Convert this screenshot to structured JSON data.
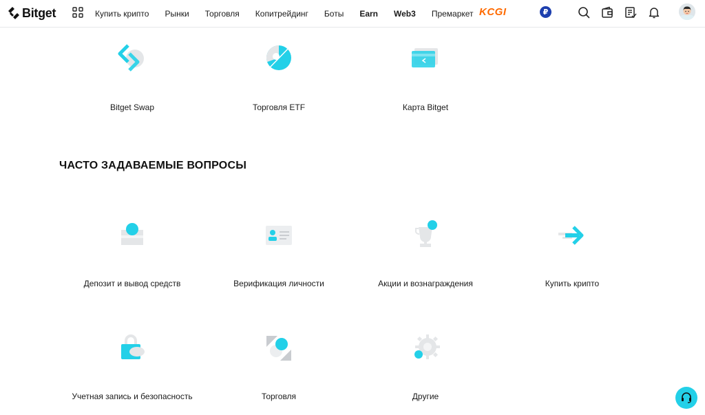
{
  "header": {
    "logo_text": "Bitget",
    "nav": [
      {
        "label": "Купить крипто",
        "bold": false
      },
      {
        "label": "Рынки",
        "bold": false
      },
      {
        "label": "Торговля",
        "bold": false
      },
      {
        "label": "Копитрейдинг",
        "bold": false
      },
      {
        "label": "Боты",
        "bold": false
      },
      {
        "label": "Earn",
        "bold": true
      },
      {
        "label": "Web3",
        "bold": true
      },
      {
        "label": "Премаркет",
        "bold": false
      }
    ],
    "promo_text": "KCGI",
    "currency_symbol": "₽",
    "tools": [
      "search-icon",
      "wallet-icon",
      "orders-icon",
      "bell-icon"
    ],
    "avatar": "avatar"
  },
  "products": [
    {
      "label": "Bitget Swap",
      "icon": "swap-icon"
    },
    {
      "label": "Торговля ETF",
      "icon": "etf-icon"
    },
    {
      "label": "Карта Bitget",
      "icon": "card-icon"
    }
  ],
  "faq": {
    "title": "ЧАСТО ЗАДАВАЕМЫЕ ВОПРОСЫ",
    "items": [
      {
        "label": "Депозит и вывод средств",
        "icon": "deposit-icon"
      },
      {
        "label": "Верификация личности",
        "icon": "id-card-icon"
      },
      {
        "label": "Акции и вознаграждения",
        "icon": "trophy-icon"
      },
      {
        "label": "Купить крипто",
        "icon": "arrow-right-icon"
      },
      {
        "label": "Учетная запись и безопасность",
        "icon": "lock-icon"
      },
      {
        "label": "Торговля",
        "icon": "trading-icon"
      },
      {
        "label": "Другие",
        "icon": "gear-icon"
      }
    ]
  },
  "colors": {
    "accent": "#23d0e8",
    "gray": "#d6d9dc",
    "promo": "#ff6a00",
    "currency_badge": "#1d3fae"
  },
  "support": {
    "icon": "headset-icon"
  }
}
